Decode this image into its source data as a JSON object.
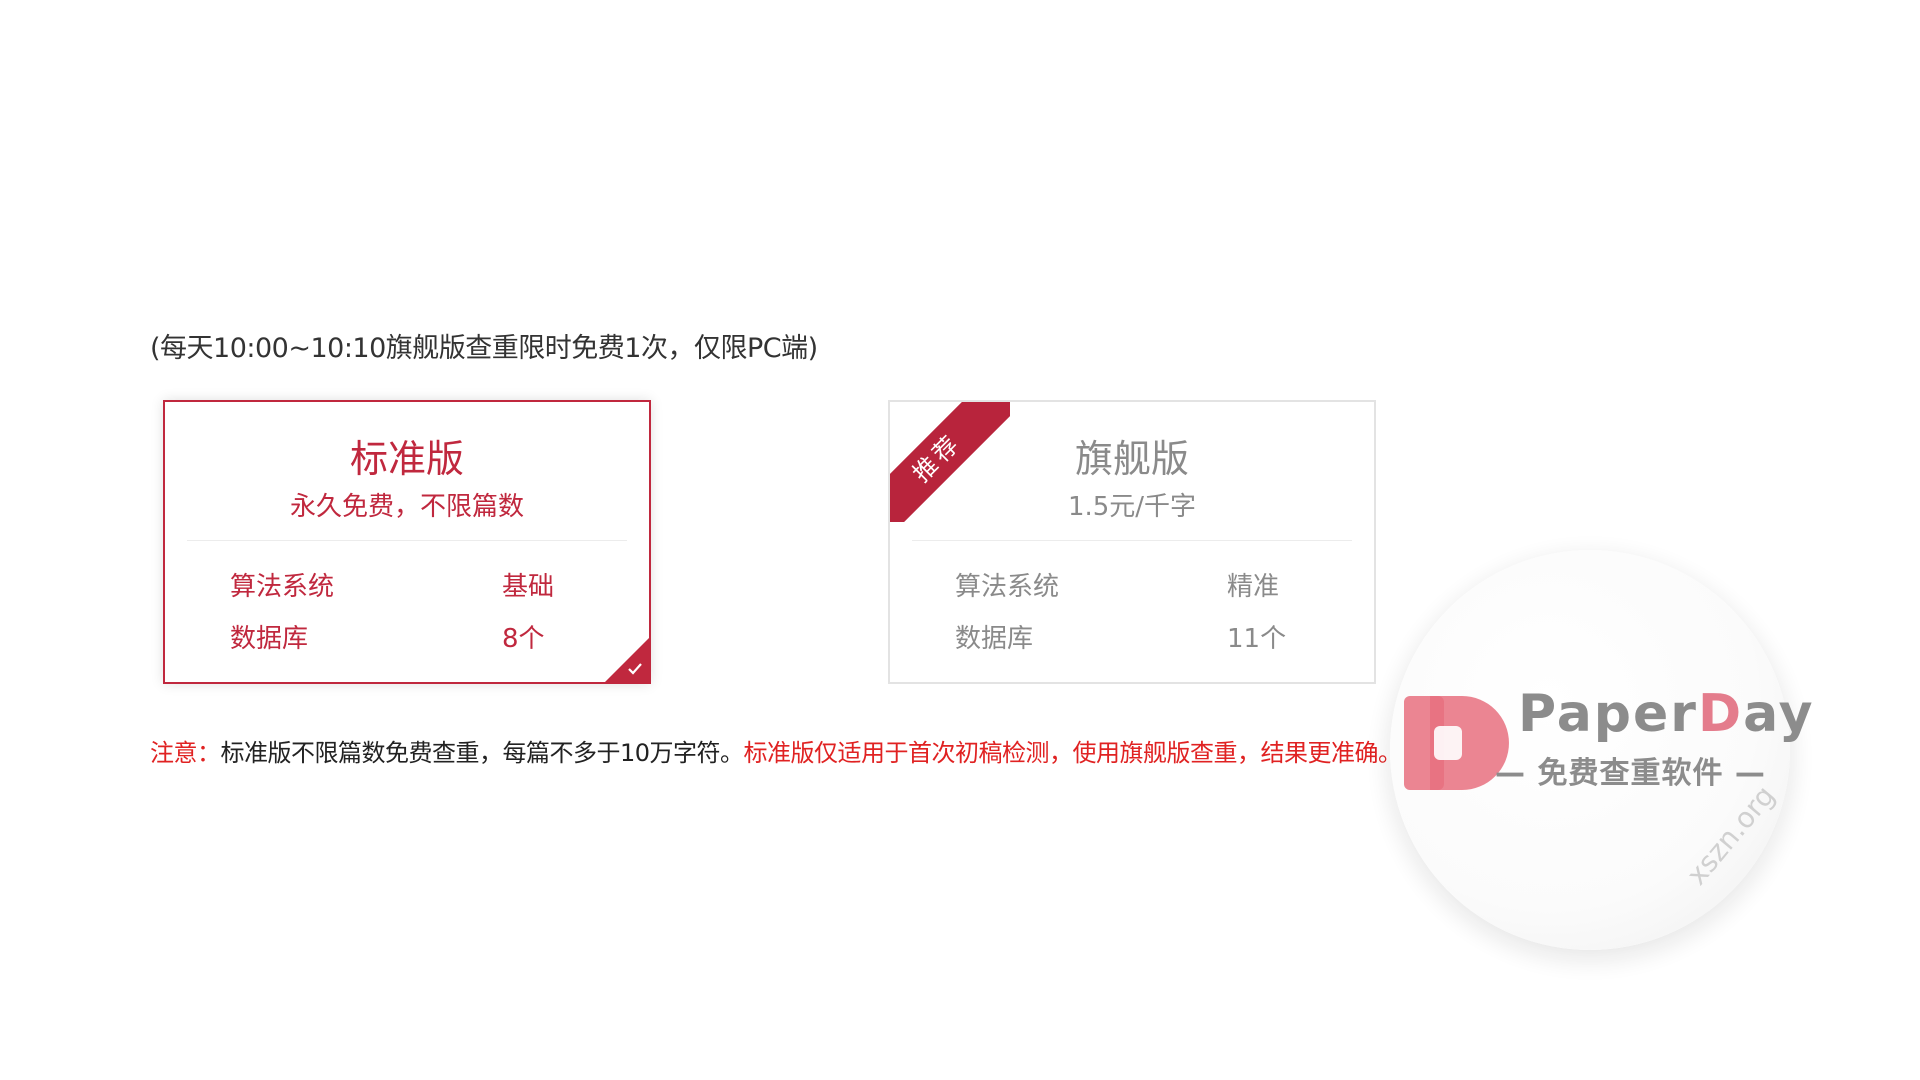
{
  "promo_text": "(每天10:00~10:10旗舰版查重限时免费1次，仅限PC端)",
  "plans": [
    {
      "name": "标准版",
      "subtitle": "永久免费，不限篇数",
      "specs": [
        {
          "key": "算法系统",
          "value": "基础"
        },
        {
          "key": "数据库",
          "value": "8个"
        }
      ]
    },
    {
      "name": "旗舰版",
      "subtitle": "1.5元/千字",
      "ribbon": "推荐",
      "specs": [
        {
          "key": "算法系统",
          "value": "精准"
        },
        {
          "key": "数据库",
          "value": "11个"
        }
      ]
    }
  ],
  "notice": {
    "label": "注意：",
    "text": "标准版不限篇数免费查重，每篇不多于10万字符。",
    "highlight": "标准版仅适用于首次初稿检测，使用旗舰版查重，结果更准确。"
  },
  "watermark": {
    "brand_a": "Paper",
    "brand_b": "D",
    "brand_c": "ay",
    "tagline": "— 免费查重软件 —",
    "site": "xszn.org"
  },
  "colors": {
    "accent": "#c0283e",
    "notice_red": "#e02222",
    "muted": "#8a8a8a"
  }
}
